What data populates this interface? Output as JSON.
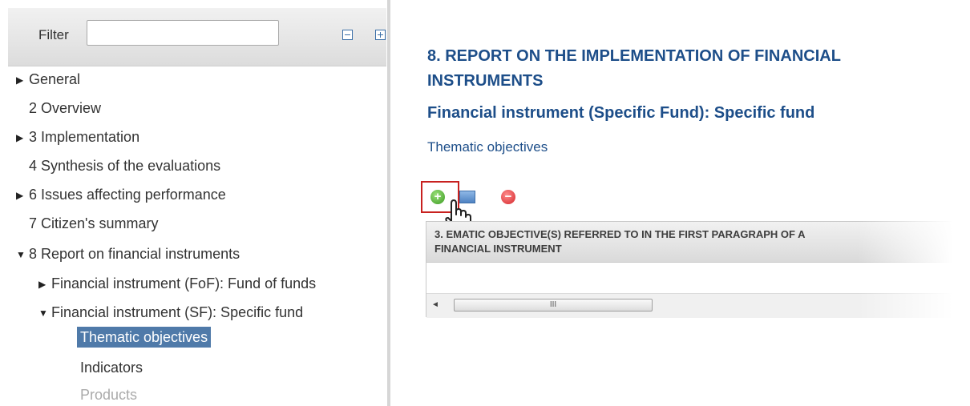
{
  "filter": {
    "label": "Filter",
    "value": "",
    "placeholder": ""
  },
  "tree": [
    {
      "label": "General",
      "arrow": "▶"
    },
    {
      "label": "2 Overview",
      "arrow": ""
    },
    {
      "label": "3 Implementation",
      "arrow": "▶"
    },
    {
      "label": "4 Synthesis of the evaluations",
      "arrow": ""
    },
    {
      "label": "6 Issues affecting performance",
      "arrow": "▶"
    },
    {
      "label": "7 Citizen's summary",
      "arrow": ""
    },
    {
      "label": "8 Report on financial instruments",
      "arrow": "▼"
    },
    {
      "label": "Financial instrument (FoF): Fund of funds",
      "arrow": "▶"
    },
    {
      "label": "Financial instrument (SF): Specific fund",
      "arrow": "▼"
    },
    {
      "label": "Thematic objectives",
      "arrow": ""
    },
    {
      "label": "Indicators",
      "arrow": ""
    },
    {
      "label": "Products",
      "arrow": ""
    }
  ],
  "content": {
    "section_title_line1": "8. REPORT ON THE IMPLEMENTATION OF FINANCIAL",
    "section_title_line2": "INSTRUMENTS",
    "sub_title": "Financial instrument (Specific Fund): Specific fund",
    "objective_label": "Thematic objectives"
  },
  "toolbar": {
    "add_glyph": "+",
    "remove_glyph": "−"
  },
  "grid": {
    "column_header_line1": "3.  EMATIC OBJECTIVE(S) REFERRED TO IN THE FIRST PARAGRAPH OF A",
    "column_header_line2": "FINANCIAL INSTRUMENT",
    "scroll_left_glyph": "◄",
    "scroll_thumb_grip": "III"
  },
  "colors": {
    "accent": "#1d4e89",
    "selected_bg": "#4f7aa9",
    "highlight": "#c8211f"
  }
}
